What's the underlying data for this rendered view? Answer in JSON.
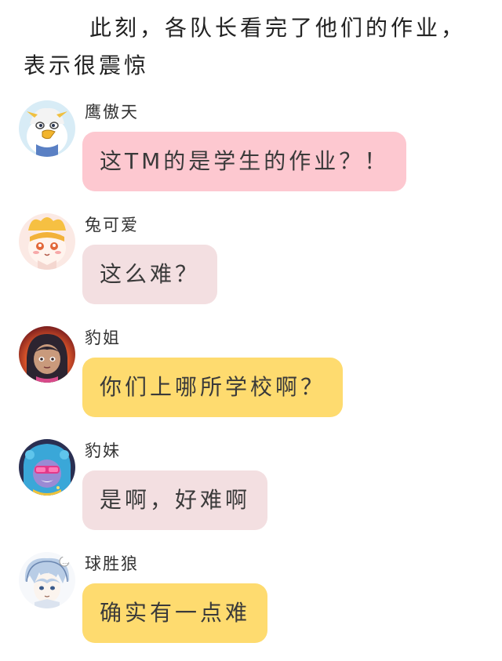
{
  "narration": "此刻，各队长看完了他们的作业，表示很震惊",
  "messages": [
    {
      "name": "鹰傲天",
      "text": "这TM的是学生的作业？！",
      "bubble_color": "#fdc8d0",
      "avatar_icon": "eagle-avatar-icon"
    },
    {
      "name": "兔可爱",
      "text": "这么难？",
      "bubble_color": "#f3dfe1",
      "avatar_icon": "rabbit-avatar-icon"
    },
    {
      "name": "豹姐",
      "text": "你们上哪所学校啊？",
      "bubble_color": "#fedb6f",
      "avatar_icon": "leopard-sister-avatar-icon"
    },
    {
      "name": "豹妹",
      "text": "是啊，好难啊",
      "bubble_color": "#f3dfe1",
      "avatar_icon": "leopard-girl-avatar-icon"
    },
    {
      "name": "球胜狼",
      "text": "确实有一点难",
      "bubble_color": "#fedb6f",
      "avatar_icon": "wolf-avatar-icon"
    }
  ]
}
